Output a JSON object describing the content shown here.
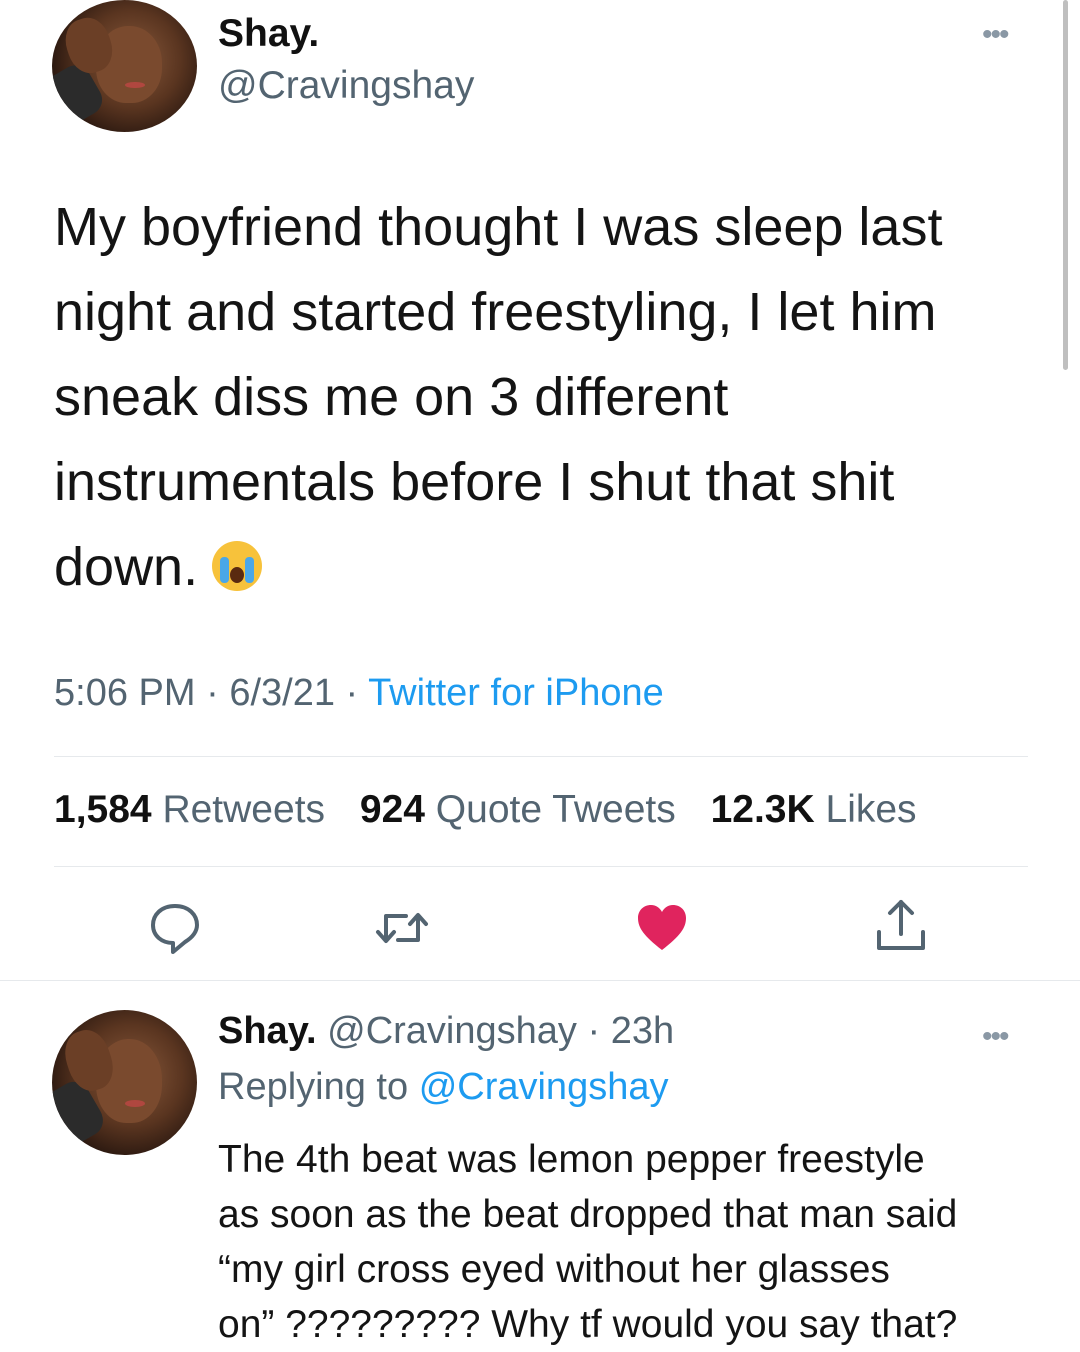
{
  "tweet": {
    "name": "Shay.",
    "handle": "@Cravingshay",
    "lines": [
      "My boyfriend thought I was sleep last",
      "night and started freestyling, I  let him",
      "sneak diss me on 3 different",
      "instrumentals before I shut that shit",
      "down."
    ],
    "emoji": "loudly-crying-face",
    "time": "5:06 PM",
    "date": "6/3/21",
    "source": "Twitter for iPhone",
    "separator": "·"
  },
  "stats": {
    "retweets_count": "1,584",
    "retweets_label": "Retweets",
    "quotes_count": "924",
    "quotes_label": "Quote Tweets",
    "likes_count": "12.3K",
    "likes_label": "Likes"
  },
  "actions": {
    "reply_icon": "reply-icon",
    "retweet_icon": "retweet-icon",
    "like_icon": "heart-icon",
    "like_active": true,
    "like_color": "#e0245e",
    "share_icon": "share-icon"
  },
  "reply": {
    "name": "Shay.",
    "handle": "@Cravingshay",
    "time": "23h",
    "separator": "·",
    "replying_prefix": "Replying to",
    "replying_to": "@Cravingshay",
    "lines": [
      "The 4th beat was lemon pepper freestyle",
      "as soon as the beat dropped that man said",
      "“my girl cross eyed without her glasses",
      "on” ????????? Why tf would you say that?"
    ]
  },
  "colors": {
    "link": "#1d9bf0",
    "secondary_text": "#536471",
    "divider": "#e6e9ec"
  }
}
